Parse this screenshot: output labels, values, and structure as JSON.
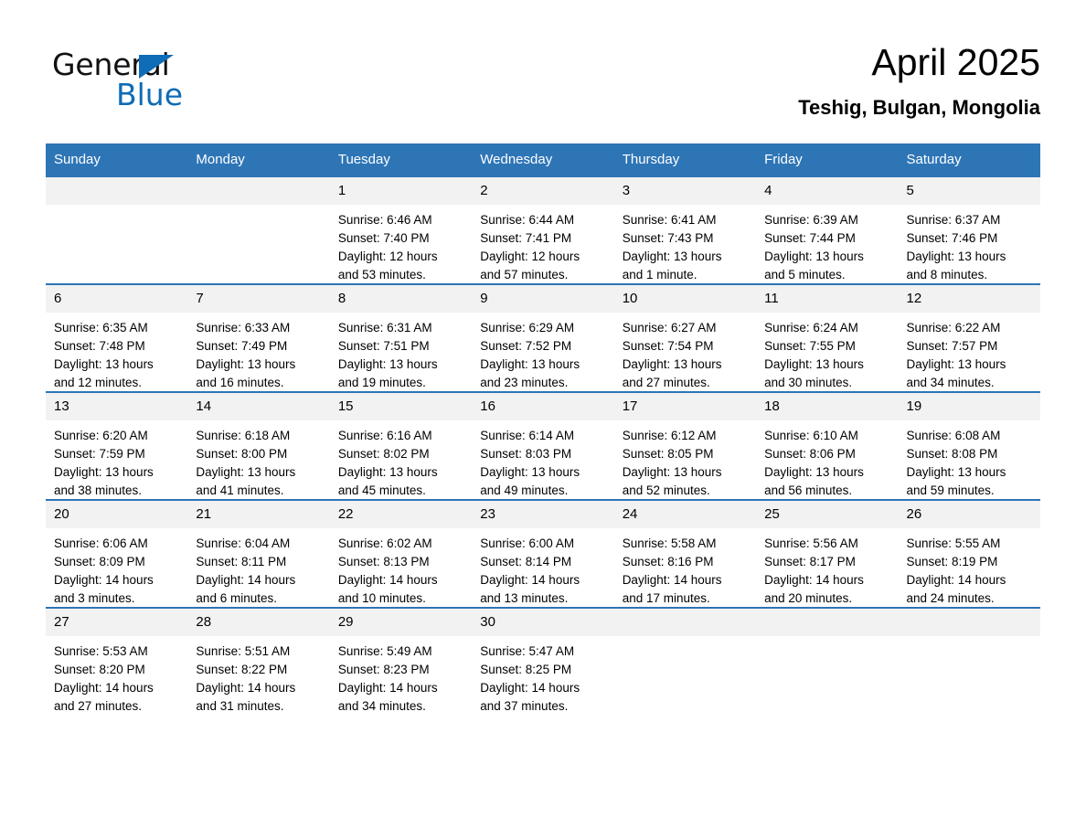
{
  "brand": {
    "name_part1": "General",
    "name_part2": "Blue",
    "accent_color": "#0f6cb6"
  },
  "header": {
    "month_title": "April 2025",
    "location": "Teshig, Bulgan, Mongolia"
  },
  "theme": {
    "header_bg": "#2e75b6",
    "date_band_bg": "#f2f2f2",
    "separator": "#2e75b6"
  },
  "calendar": {
    "weekday_headers": [
      "Sunday",
      "Monday",
      "Tuesday",
      "Wednesday",
      "Thursday",
      "Friday",
      "Saturday"
    ],
    "weeks": [
      [
        {
          "day": "",
          "empty": true
        },
        {
          "day": "",
          "empty": true
        },
        {
          "day": "1",
          "sunrise": "Sunrise: 6:46 AM",
          "sunset": "Sunset: 7:40 PM",
          "daylight_line1": "Daylight: 12 hours",
          "daylight_line2": "and 53 minutes."
        },
        {
          "day": "2",
          "sunrise": "Sunrise: 6:44 AM",
          "sunset": "Sunset: 7:41 PM",
          "daylight_line1": "Daylight: 12 hours",
          "daylight_line2": "and 57 minutes."
        },
        {
          "day": "3",
          "sunrise": "Sunrise: 6:41 AM",
          "sunset": "Sunset: 7:43 PM",
          "daylight_line1": "Daylight: 13 hours",
          "daylight_line2": "and 1 minute."
        },
        {
          "day": "4",
          "sunrise": "Sunrise: 6:39 AM",
          "sunset": "Sunset: 7:44 PM",
          "daylight_line1": "Daylight: 13 hours",
          "daylight_line2": "and 5 minutes."
        },
        {
          "day": "5",
          "sunrise": "Sunrise: 6:37 AM",
          "sunset": "Sunset: 7:46 PM",
          "daylight_line1": "Daylight: 13 hours",
          "daylight_line2": "and 8 minutes."
        }
      ],
      [
        {
          "day": "6",
          "sunrise": "Sunrise: 6:35 AM",
          "sunset": "Sunset: 7:48 PM",
          "daylight_line1": "Daylight: 13 hours",
          "daylight_line2": "and 12 minutes."
        },
        {
          "day": "7",
          "sunrise": "Sunrise: 6:33 AM",
          "sunset": "Sunset: 7:49 PM",
          "daylight_line1": "Daylight: 13 hours",
          "daylight_line2": "and 16 minutes."
        },
        {
          "day": "8",
          "sunrise": "Sunrise: 6:31 AM",
          "sunset": "Sunset: 7:51 PM",
          "daylight_line1": "Daylight: 13 hours",
          "daylight_line2": "and 19 minutes."
        },
        {
          "day": "9",
          "sunrise": "Sunrise: 6:29 AM",
          "sunset": "Sunset: 7:52 PM",
          "daylight_line1": "Daylight: 13 hours",
          "daylight_line2": "and 23 minutes."
        },
        {
          "day": "10",
          "sunrise": "Sunrise: 6:27 AM",
          "sunset": "Sunset: 7:54 PM",
          "daylight_line1": "Daylight: 13 hours",
          "daylight_line2": "and 27 minutes."
        },
        {
          "day": "11",
          "sunrise": "Sunrise: 6:24 AM",
          "sunset": "Sunset: 7:55 PM",
          "daylight_line1": "Daylight: 13 hours",
          "daylight_line2": "and 30 minutes."
        },
        {
          "day": "12",
          "sunrise": "Sunrise: 6:22 AM",
          "sunset": "Sunset: 7:57 PM",
          "daylight_line1": "Daylight: 13 hours",
          "daylight_line2": "and 34 minutes."
        }
      ],
      [
        {
          "day": "13",
          "sunrise": "Sunrise: 6:20 AM",
          "sunset": "Sunset: 7:59 PM",
          "daylight_line1": "Daylight: 13 hours",
          "daylight_line2": "and 38 minutes."
        },
        {
          "day": "14",
          "sunrise": "Sunrise: 6:18 AM",
          "sunset": "Sunset: 8:00 PM",
          "daylight_line1": "Daylight: 13 hours",
          "daylight_line2": "and 41 minutes."
        },
        {
          "day": "15",
          "sunrise": "Sunrise: 6:16 AM",
          "sunset": "Sunset: 8:02 PM",
          "daylight_line1": "Daylight: 13 hours",
          "daylight_line2": "and 45 minutes."
        },
        {
          "day": "16",
          "sunrise": "Sunrise: 6:14 AM",
          "sunset": "Sunset: 8:03 PM",
          "daylight_line1": "Daylight: 13 hours",
          "daylight_line2": "and 49 minutes."
        },
        {
          "day": "17",
          "sunrise": "Sunrise: 6:12 AM",
          "sunset": "Sunset: 8:05 PM",
          "daylight_line1": "Daylight: 13 hours",
          "daylight_line2": "and 52 minutes."
        },
        {
          "day": "18",
          "sunrise": "Sunrise: 6:10 AM",
          "sunset": "Sunset: 8:06 PM",
          "daylight_line1": "Daylight: 13 hours",
          "daylight_line2": "and 56 minutes."
        },
        {
          "day": "19",
          "sunrise": "Sunrise: 6:08 AM",
          "sunset": "Sunset: 8:08 PM",
          "daylight_line1": "Daylight: 13 hours",
          "daylight_line2": "and 59 minutes."
        }
      ],
      [
        {
          "day": "20",
          "sunrise": "Sunrise: 6:06 AM",
          "sunset": "Sunset: 8:09 PM",
          "daylight_line1": "Daylight: 14 hours",
          "daylight_line2": "and 3 minutes."
        },
        {
          "day": "21",
          "sunrise": "Sunrise: 6:04 AM",
          "sunset": "Sunset: 8:11 PM",
          "daylight_line1": "Daylight: 14 hours",
          "daylight_line2": "and 6 minutes."
        },
        {
          "day": "22",
          "sunrise": "Sunrise: 6:02 AM",
          "sunset": "Sunset: 8:13 PM",
          "daylight_line1": "Daylight: 14 hours",
          "daylight_line2": "and 10 minutes."
        },
        {
          "day": "23",
          "sunrise": "Sunrise: 6:00 AM",
          "sunset": "Sunset: 8:14 PM",
          "daylight_line1": "Daylight: 14 hours",
          "daylight_line2": "and 13 minutes."
        },
        {
          "day": "24",
          "sunrise": "Sunrise: 5:58 AM",
          "sunset": "Sunset: 8:16 PM",
          "daylight_line1": "Daylight: 14 hours",
          "daylight_line2": "and 17 minutes."
        },
        {
          "day": "25",
          "sunrise": "Sunrise: 5:56 AM",
          "sunset": "Sunset: 8:17 PM",
          "daylight_line1": "Daylight: 14 hours",
          "daylight_line2": "and 20 minutes."
        },
        {
          "day": "26",
          "sunrise": "Sunrise: 5:55 AM",
          "sunset": "Sunset: 8:19 PM",
          "daylight_line1": "Daylight: 14 hours",
          "daylight_line2": "and 24 minutes."
        }
      ],
      [
        {
          "day": "27",
          "sunrise": "Sunrise: 5:53 AM",
          "sunset": "Sunset: 8:20 PM",
          "daylight_line1": "Daylight: 14 hours",
          "daylight_line2": "and 27 minutes."
        },
        {
          "day": "28",
          "sunrise": "Sunrise: 5:51 AM",
          "sunset": "Sunset: 8:22 PM",
          "daylight_line1": "Daylight: 14 hours",
          "daylight_line2": "and 31 minutes."
        },
        {
          "day": "29",
          "sunrise": "Sunrise: 5:49 AM",
          "sunset": "Sunset: 8:23 PM",
          "daylight_line1": "Daylight: 14 hours",
          "daylight_line2": "and 34 minutes."
        },
        {
          "day": "30",
          "sunrise": "Sunrise: 5:47 AM",
          "sunset": "Sunset: 8:25 PM",
          "daylight_line1": "Daylight: 14 hours",
          "daylight_line2": "and 37 minutes."
        },
        {
          "day": "",
          "empty": true
        },
        {
          "day": "",
          "empty": true
        },
        {
          "day": "",
          "empty": true
        }
      ]
    ]
  }
}
